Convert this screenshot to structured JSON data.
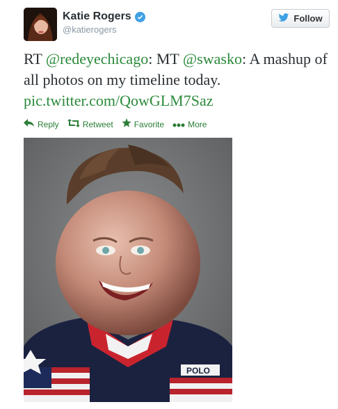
{
  "user": {
    "name": "Katie Rogers",
    "handle": "@katierogers"
  },
  "follow_button": {
    "label": "Follow"
  },
  "tweet": {
    "prefix": "RT ",
    "mention1": "@redeyechicago",
    "middle": ": MT ",
    "mention2": "@swasko",
    "text": ": A mashup of all photos on my timeline today. ",
    "link": "pic.twitter.com/QowGLM7Saz"
  },
  "actions": {
    "reply": "Reply",
    "retweet": "Retweet",
    "favorite": "Favorite",
    "more": "More"
  },
  "media": {
    "shirt_text": "POLO"
  },
  "colors": {
    "link_green": "#2a8a3a",
    "verified_blue": "#3fa1e5"
  },
  "icons": [
    "verified-badge-icon",
    "twitter-bird-icon",
    "reply-icon",
    "retweet-icon",
    "star-icon",
    "more-dots-icon"
  ]
}
